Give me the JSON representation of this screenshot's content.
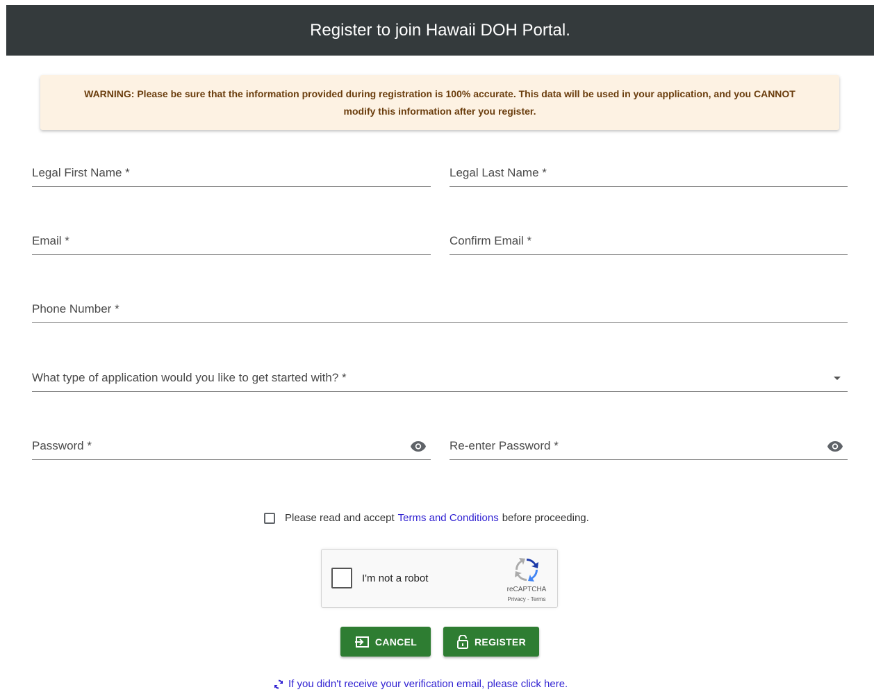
{
  "header": {
    "title": "Register to join Hawaii DOH Portal."
  },
  "warning": {
    "text": "WARNING: Please be sure that the information provided during registration is 100% accurate. This data will be used in your application, and you CANNOT modify this information after you register."
  },
  "form": {
    "first_name_label": "Legal First Name *",
    "last_name_label": "Legal Last Name *",
    "email_label": "Email *",
    "confirm_email_label": "Confirm Email *",
    "phone_label": "Phone Number *",
    "application_type_label": "What type of application would you like to get started with? *",
    "password_label": "Password *",
    "reenter_password_label": "Re-enter Password *"
  },
  "terms": {
    "prefix": "Please read and accept",
    "link": "Terms and Conditions",
    "suffix": "before proceeding."
  },
  "captcha": {
    "label": "I'm not a robot",
    "brand": "reCAPTCHA",
    "links": "Privacy - Terms"
  },
  "buttons": {
    "cancel": "CANCEL",
    "register": "REGISTER"
  },
  "resend": {
    "text": "If you didn't receive your verification email, please click here."
  },
  "colors": {
    "header_bg": "#343a3c",
    "warning_bg": "#fdf2e3",
    "button_green": "#2e7d32",
    "link_blue": "#2e1fd1"
  }
}
